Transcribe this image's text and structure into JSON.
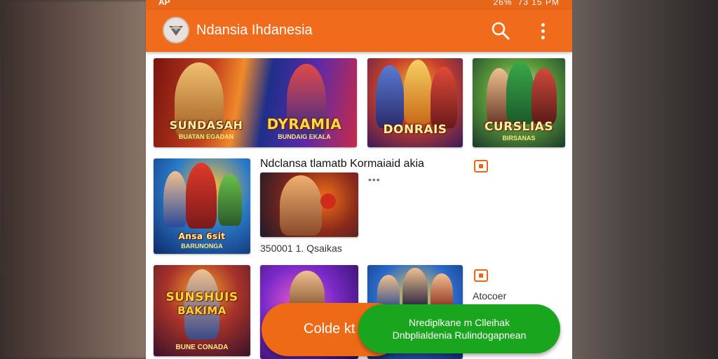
{
  "status_bar": {
    "left": "AP",
    "right": "73 15 PM",
    "battery": "26%"
  },
  "app_bar": {
    "title": "Ndansia Ihdanesia",
    "logo_icon": "diamond-shield-icon",
    "search_icon": "search-icon",
    "menu_icon": "more-vert-icon"
  },
  "games_row1": [
    {
      "title": "SUNDASAH",
      "subtitle": "BUATAN EGADAN",
      "color": "#c2401e"
    },
    {
      "title": "DYRAMIA",
      "subtitle": "BUNDAIG EKALA",
      "color": "#5a2aa8"
    },
    {
      "title": "DONRAIS",
      "subtitle": "",
      "color": "#f2b033"
    },
    {
      "title": "CURSLIAS",
      "subtitle": "BIRSANAS",
      "color": "#5a9a3a"
    }
  ],
  "featured": {
    "title": "Ndclansa tlamatb Kormaiaid akia",
    "more": "•••",
    "thumb_a_title": "Ansa 6sit",
    "thumb_a_subtitle": "BARUNONGA",
    "price": "350001 1. Qsaikas"
  },
  "games_row3": [
    {
      "title": "SUNSHUIS",
      "title2": "BAKIMA",
      "subtitle": "BUNE CONADA"
    },
    {
      "title": "",
      "subtitle": ""
    },
    {
      "title": "",
      "subtitle": ""
    }
  ],
  "side_label": "Atocoer",
  "fab_orange": {
    "label": "Colde kt"
  },
  "fab_green": {
    "line1": "Nrediplkane m Clleihak",
    "line2": "Dnbplialdenia Rulindogapnean"
  },
  "colors": {
    "accent": "#f06c1c",
    "green": "#1aa51f"
  }
}
